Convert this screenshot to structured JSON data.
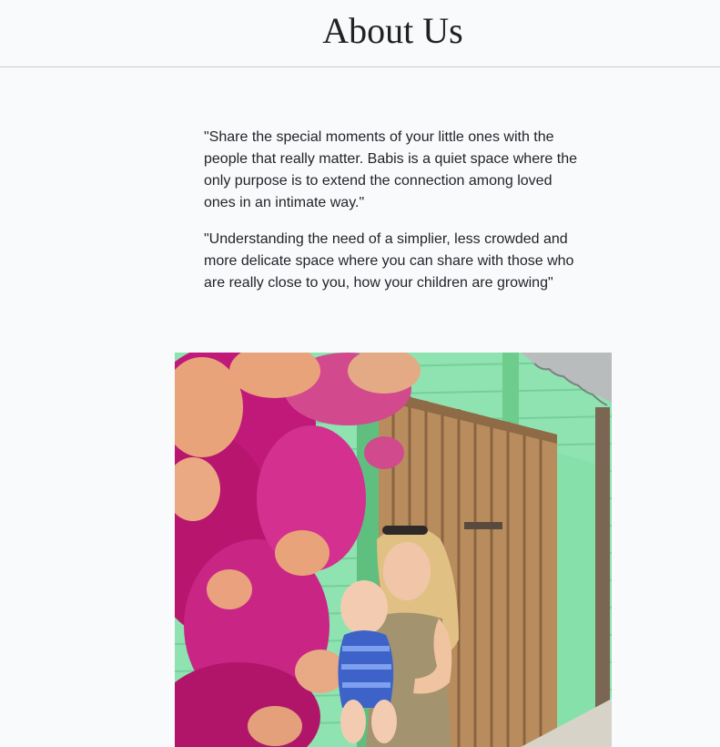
{
  "header": {
    "title": "About Us"
  },
  "about": {
    "quotes": [
      "\"Share the special moments of your little ones with the people that really matter. Babis is a quiet space where the only purpose is to extend the connection among loved ones in an intimate way.\"",
      "\"Understanding the need of a simplier, less crowded and more delicate space where you can share with those who are really close to you, how your children are growing\""
    ]
  },
  "photo": {
    "subject": "mother-holding-baby-photo",
    "colors": {
      "wall": "#8fe3b0",
      "door": "#b98c5d",
      "flowers_magenta": "#c0197a",
      "flowers_peach": "#e9a37a"
    }
  }
}
